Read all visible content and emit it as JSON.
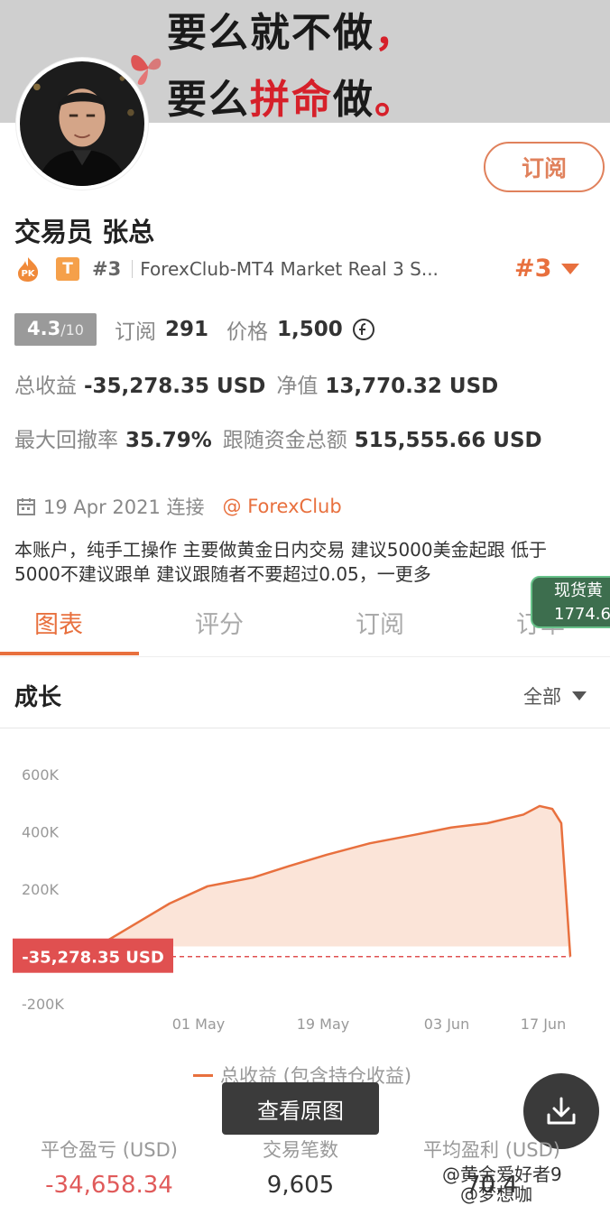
{
  "banner": {
    "line1": "要么就不做",
    "line1_comma": "，",
    "line2_prefix": "要么",
    "line2_red": "拼命",
    "line2_suffix": "做",
    "line2_period": "。"
  },
  "profile": {
    "subscribe_label": "订阅",
    "trader_name": "交易员  张总",
    "badge_t": "T",
    "rank_small": "#3",
    "server": "ForexClub-MT4 Market Real 3 S...",
    "rank_big": "#3"
  },
  "stats": {
    "score": "4.3",
    "score_denom": "/10",
    "subscriptions_label": "订阅",
    "subscriptions": "291",
    "price_label": "价格",
    "price": "1,500",
    "total_profit_label": "总收益",
    "total_profit": "-35,278.35 USD",
    "equity_label": "净值",
    "equity": "13,770.32 USD",
    "max_drawdown_label": "最大回撤率",
    "max_drawdown": "35.79%",
    "follow_funds_label": "跟随资金总额",
    "follow_funds": "515,555.66 USD"
  },
  "meta": {
    "date": "19 Apr 2021 连接",
    "broker": "@ ForexClub"
  },
  "description": "本账户，纯手工操作 主要做黄金日内交易   建议5000美金起跟  低于5000不建议跟单 建议跟随者不要超过0.05，一更多",
  "gold_tag": {
    "label": "现货黄",
    "price": "1774.6"
  },
  "tabs": [
    {
      "label": "图表"
    },
    {
      "label": "评分"
    },
    {
      "label": "订阅"
    },
    {
      "label": "订单"
    }
  ],
  "growth": {
    "title": "成长",
    "range": "全部"
  },
  "chart_data": {
    "type": "area",
    "title": "",
    "y_ticks": [
      "600K",
      "400K",
      "200K",
      "-200K"
    ],
    "x_ticks": [
      "01 May",
      "19 May",
      "03 Jun",
      "17 Jun"
    ],
    "ylim": [
      -200000,
      600000
    ],
    "current_value_label": "-35,278.35 USD",
    "current_value": -35278.35,
    "series": [
      {
        "name": "总收益 (包含持仓收益)",
        "x": [
          "Apr 23",
          "Apr 27",
          "May 01",
          "May 05",
          "May 10",
          "May 15",
          "May 19",
          "May 24",
          "May 29",
          "Jun 03",
          "Jun 08",
          "Jun 13",
          "Jun 16",
          "Jun 18",
          "Jun 20",
          "Jun 21"
        ],
        "values": [
          0,
          60000,
          150000,
          210000,
          240000,
          280000,
          320000,
          360000,
          390000,
          415000,
          430000,
          460000,
          490000,
          480000,
          430000,
          -35278
        ]
      }
    ],
    "colors": {
      "line": "#e8703e",
      "fill": "#fbe1d4",
      "label_bg": "#e05050"
    }
  },
  "legend_label": "总收益 (包含持仓收益)",
  "actions": {
    "view_original": "查看原图"
  },
  "bottom_stats": [
    {
      "label": "平仓盈亏 (USD)",
      "value": "-34,658.34"
    },
    {
      "label": "交易笔数",
      "value": "9,605"
    },
    {
      "label": "平均盈利 (USD)",
      "value": "70.4"
    }
  ],
  "watermark": {
    "line1": "@黄金爱好者9",
    "line2": "@梦想咖"
  }
}
